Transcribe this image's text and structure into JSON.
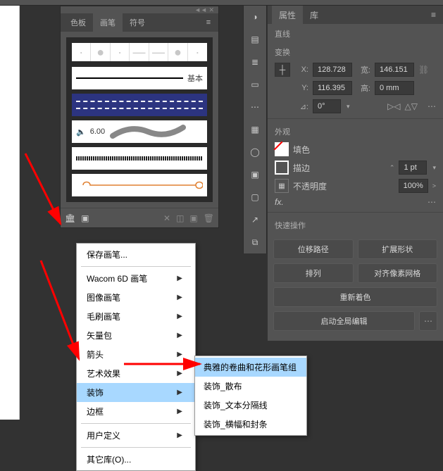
{
  "properties_panel": {
    "tab_properties": "属性",
    "tab_library": "库",
    "section_line": "直线",
    "section_transform": "变换",
    "x_label": "X:",
    "y_label": "Y:",
    "w_label": "宽:",
    "h_label": "高:",
    "x_value": "128.728",
    "y_value": "116.395",
    "w_value": "146.151",
    "h_value": "0 mm",
    "rotate_label": "⊿:",
    "rotate_value": "0°",
    "section_appearance": "外观",
    "fill_label": "填色",
    "stroke_label": "描边",
    "stroke_value": "1 pt",
    "opacity_label": "不透明度",
    "opacity_value": "100%",
    "fx_label": "fx.",
    "section_quick": "快速操作",
    "btn_offset": "位移路径",
    "btn_expand": "扩展形状",
    "btn_arrange": "排列",
    "btn_align": "对齐像素网格",
    "btn_recolor": "重新着色",
    "btn_global_edit": "启动全局编辑"
  },
  "brush_panel": {
    "tab_swatches": "色板",
    "tab_brushes": "画笔",
    "tab_symbols": "符号",
    "basic_label": "基本",
    "stroke_size": "6.00"
  },
  "context_menu": {
    "save_brushes": "保存画笔...",
    "wacom": "Wacom 6D 画笔",
    "image_brush": "图像画笔",
    "bristle": "毛刷画笔",
    "vector": "矢量包",
    "arrows": "箭头",
    "art_effects": "艺术效果",
    "decorative": "装饰",
    "border": "边框",
    "user_defined": "用户定义",
    "other_lib": "其它库(O)..."
  },
  "submenu": {
    "elegant_curl": "典雅的卷曲和花形画笔组",
    "scatter": "装饰_散布",
    "text_divider": "装饰_文本分隔线",
    "banners": "装饰_横幅和封条"
  }
}
